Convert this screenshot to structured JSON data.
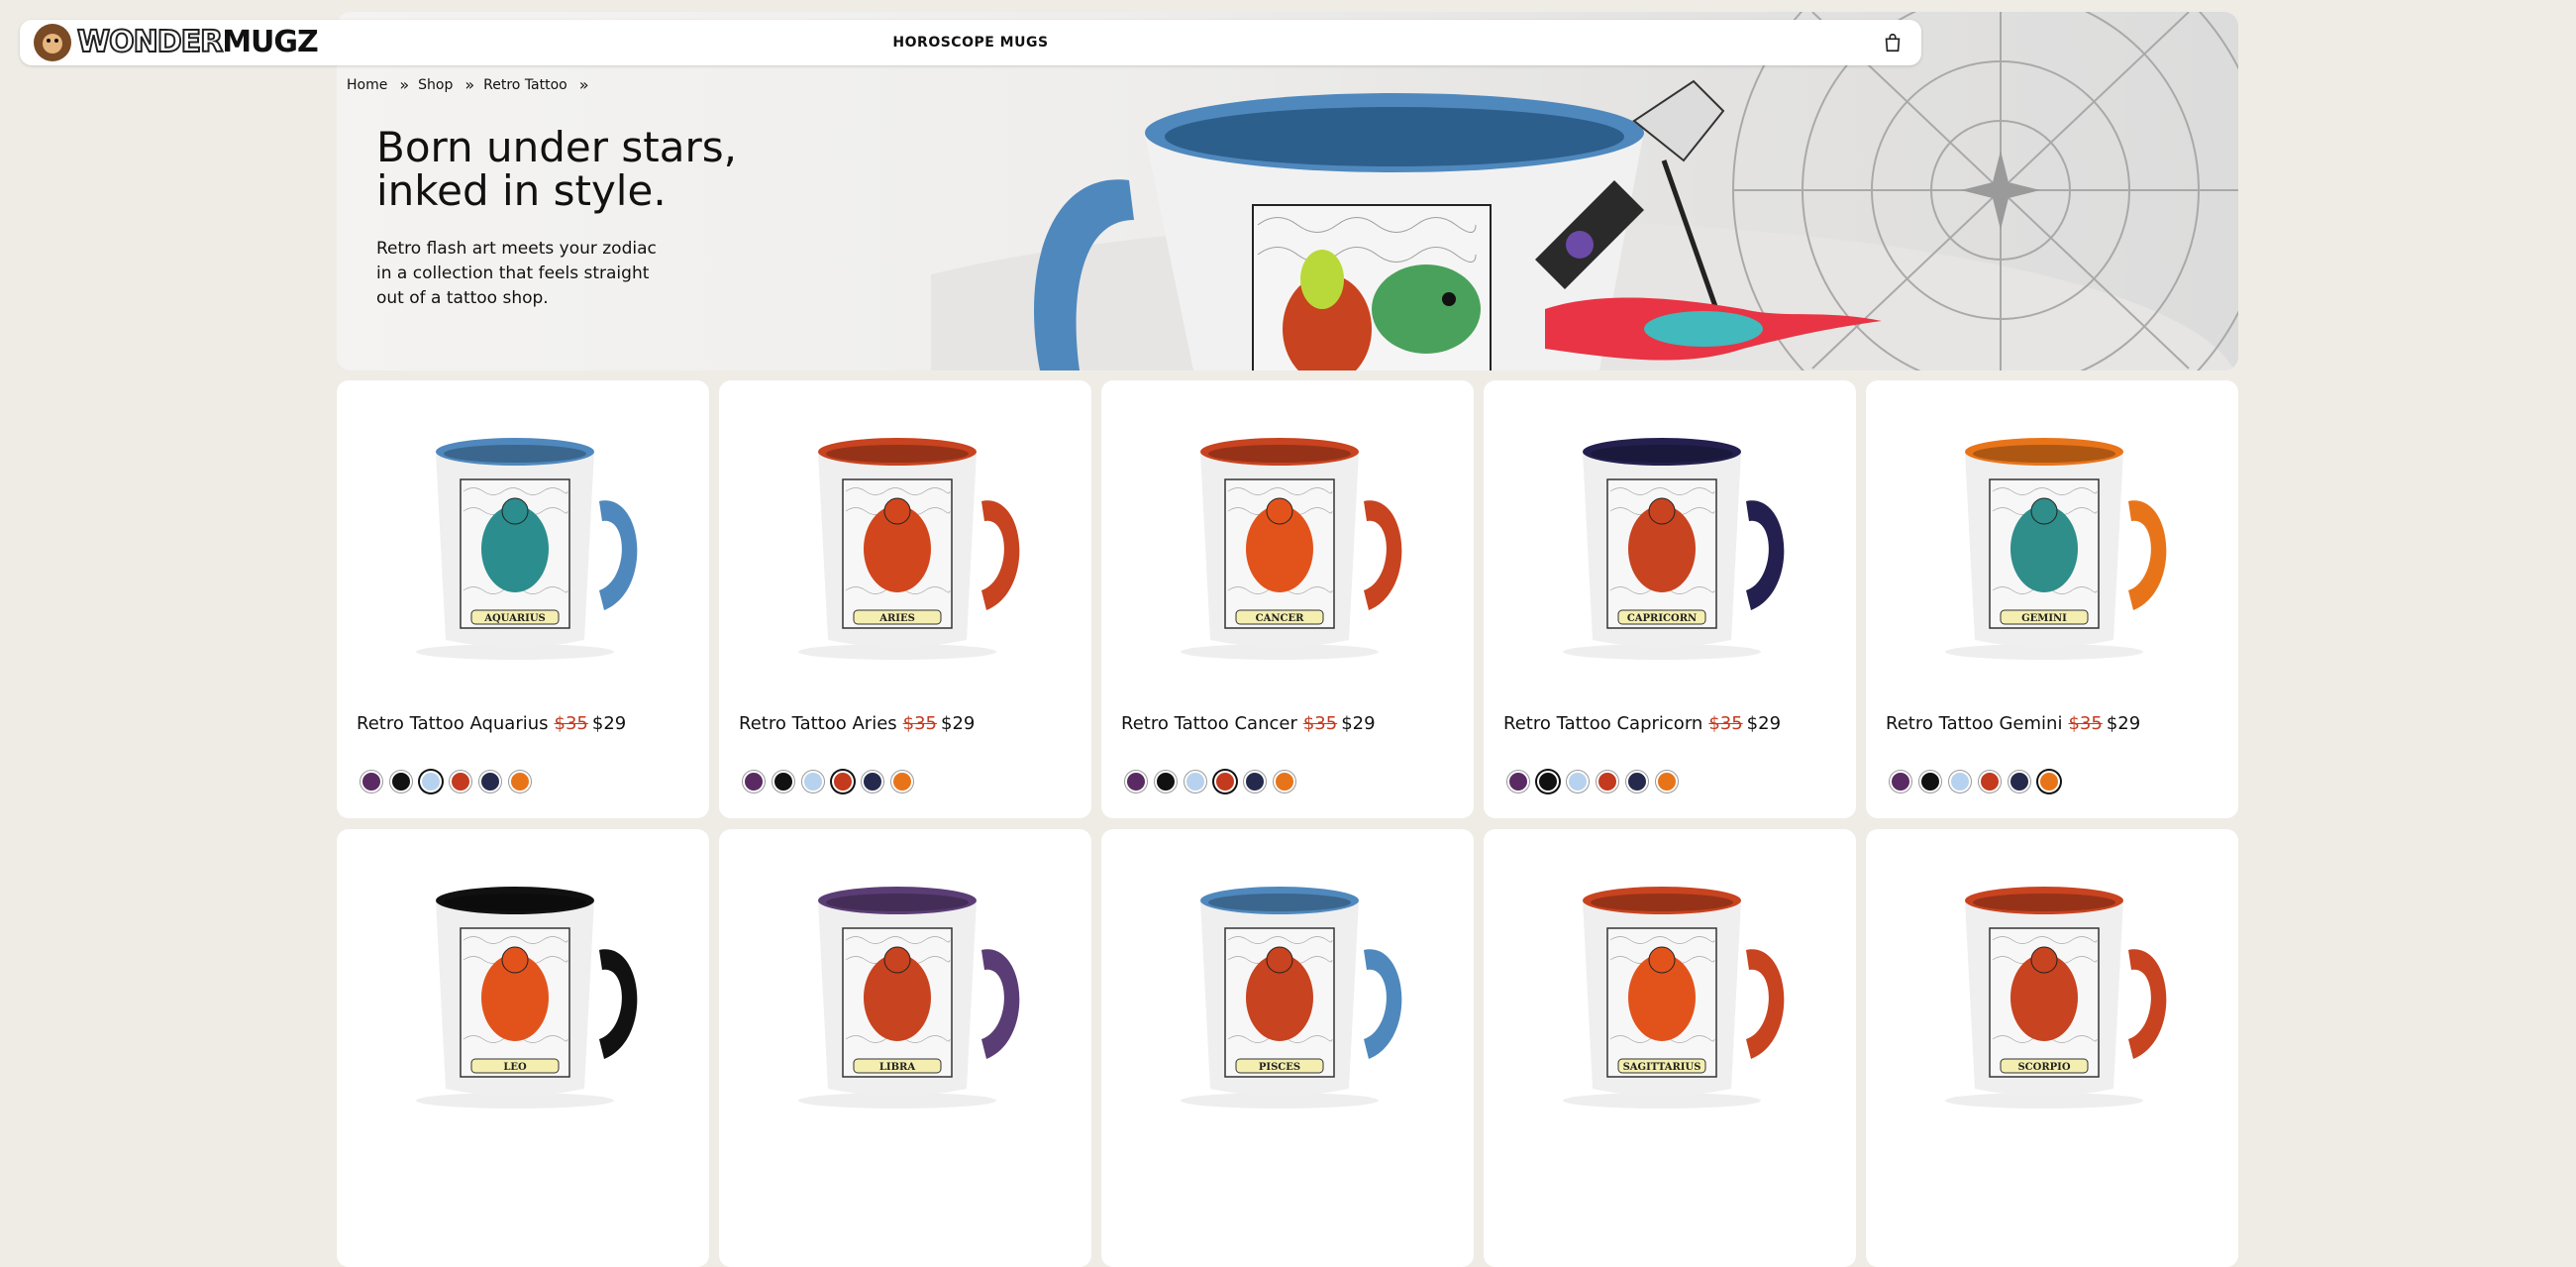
{
  "nav": {
    "logo_part1": "WONDER",
    "logo_part2": "MUGZ",
    "title": "HOROSCOPE MUGS",
    "cart_icon": "shopping-bag-icon"
  },
  "breadcrumb": [
    "Home",
    "Shop",
    "Retro Tattoo"
  ],
  "hero": {
    "heading_line1": "Born under stars,",
    "heading_line2": "inked in style.",
    "text": "Retro flash art meets your zodiac in a collection that feels straight out of a tattoo shop."
  },
  "swatch_colors": [
    "#5a2a63",
    "#111111",
    "#b6d2ee",
    "#c33a1f",
    "#252a4d",
    "#e8741a"
  ],
  "products": [
    {
      "name": "Retro Tattoo Aquarius",
      "old_price": "$35",
      "price": "$29",
      "label": "AQUARIUS",
      "accent": "#4f88bd",
      "art": "#2b8d8d",
      "selected": 2
    },
    {
      "name": "Retro Tattoo Aries",
      "old_price": "$35",
      "price": "$29",
      "label": "ARIES",
      "accent": "#c8431f",
      "art": "#d2461d",
      "selected": 3
    },
    {
      "name": "Retro Tattoo Cancer",
      "old_price": "$35",
      "price": "$29",
      "label": "CANCER",
      "accent": "#c8431f",
      "art": "#e2531c",
      "selected": 3
    },
    {
      "name": "Retro Tattoo Capricorn",
      "old_price": "$35",
      "price": "$29",
      "label": "CAPRICORN",
      "accent": "#23204f",
      "art": "#c8431f",
      "selected": 1
    },
    {
      "name": "Retro Tattoo Gemini",
      "old_price": "$35",
      "price": "$29",
      "label": "GEMINI",
      "accent": "#e8741a",
      "art": "#2f8d8a",
      "selected": 5
    },
    {
      "name": "",
      "old_price": "",
      "price": "",
      "label": "LEO",
      "accent": "#111111",
      "art": "#e2531c",
      "selected": -1
    },
    {
      "name": "",
      "old_price": "",
      "price": "",
      "label": "LIBRA",
      "accent": "#5b3d75",
      "art": "#c8431f",
      "selected": -1
    },
    {
      "name": "",
      "old_price": "",
      "price": "",
      "label": "PISCES",
      "accent": "#4f88bd",
      "art": "#c8431f",
      "selected": -1
    },
    {
      "name": "",
      "old_price": "",
      "price": "",
      "label": "SAGITTARIUS",
      "accent": "#c8431f",
      "art": "#e2531c",
      "selected": -1
    },
    {
      "name": "",
      "old_price": "",
      "price": "",
      "label": "SCORPIO",
      "accent": "#c8431f",
      "art": "#c8431f",
      "selected": -1
    }
  ]
}
